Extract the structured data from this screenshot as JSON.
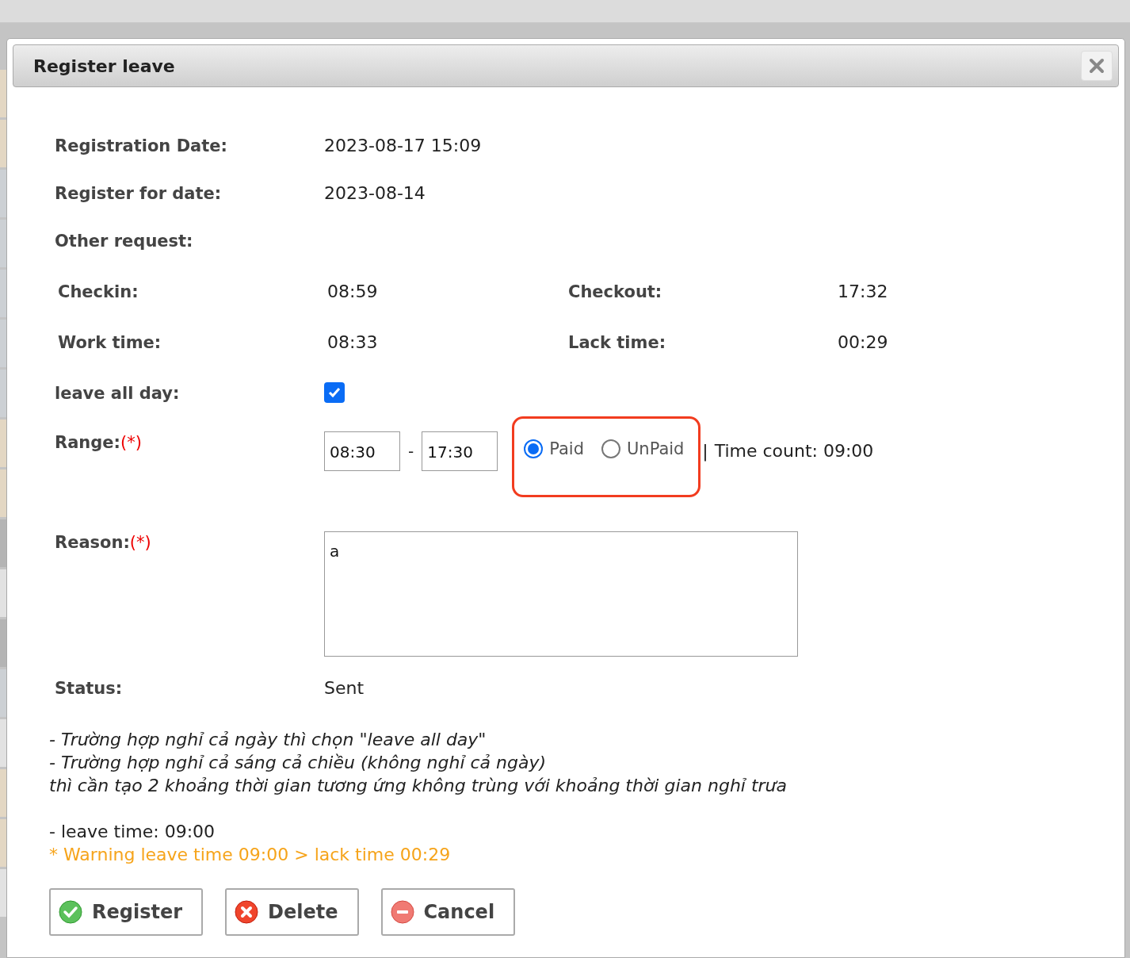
{
  "dialog": {
    "title": "Register leave"
  },
  "fields": [
    {
      "label": "Registration Date:",
      "value": "2023-08-17 15:09"
    },
    {
      "label": "Register for date:",
      "value": "2023-08-14"
    },
    {
      "label": "Other request:"
    }
  ],
  "times": [
    {
      "label": "Checkin:",
      "value": "08:59"
    },
    {
      "label": "Checkout:",
      "value": "17:32"
    },
    {
      "label": "Work time:",
      "value": "08:33"
    },
    {
      "label": "Lack time:",
      "value": "00:29"
    }
  ],
  "leave_all_day": {
    "label": "leave all day:",
    "checked": true
  },
  "range": {
    "label": "Range:",
    "required_mark": "(*)",
    "from": "08:30",
    "separator": "-",
    "to": "17:30",
    "pay_options": [
      {
        "label": "Paid",
        "selected": true
      },
      {
        "label": "UnPaid",
        "selected": false
      }
    ],
    "divider": "|",
    "time_count": "Time count: 09:00"
  },
  "reason": {
    "label": "Reason:",
    "required_mark": "(*)",
    "value": "a"
  },
  "status": {
    "label": "Status:",
    "value": "Sent"
  },
  "notes": [
    "- Trường hợp nghỉ cả ngày thì chọn \"leave all day\"",
    "- Trường hợp nghỉ cả sáng cả chiều (không nghỉ cả ngày)",
    "thì cần tạo 2 khoảng thời gian tương ứng không trùng với khoảng thời gian nghỉ trưa"
  ],
  "leave_time": "- leave time: 09:00",
  "warning": "* Warning leave time 09:00 > lack time 00:29",
  "buttons": [
    {
      "label": "Register",
      "kind": "register"
    },
    {
      "label": "Delete",
      "kind": "delete"
    },
    {
      "label": "Cancel",
      "kind": "cancel"
    }
  ]
}
